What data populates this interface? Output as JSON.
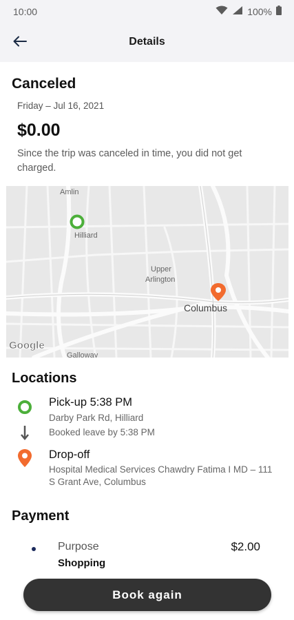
{
  "status_bar": {
    "time": "10:00",
    "battery": "100%",
    "icons": [
      "wifi-icon",
      "cell-signal-icon",
      "battery-icon"
    ]
  },
  "app_bar": {
    "back_icon": "arrow-left-icon",
    "title": "Details"
  },
  "trip": {
    "status": "Canceled",
    "date": "Friday – Jul 16, 2021",
    "amount": "$0.00",
    "note": "Since the trip was canceled in time, you did not get charged."
  },
  "map": {
    "labels": {
      "amlin": "Amlin",
      "hilliard": "Hilliard",
      "upper_arlington_1": "Upper",
      "upper_arlington_2": "Arlington",
      "columbus": "Columbus",
      "galloway": "Galloway",
      "google": "Google"
    },
    "colors": {
      "pickup": "#4caf3a",
      "dropoff": "#f26b2e"
    }
  },
  "locations": {
    "title": "Locations",
    "pickup": {
      "label": "Pick-up 5:38 PM",
      "address": "Darby Park Rd, Hilliard",
      "booked": "Booked leave by 5:38 PM"
    },
    "dropoff": {
      "label": "Drop-off",
      "address": "Hospital Medical Services Chawdry Fatima I MD – 111 S Grant Ave, Columbus"
    }
  },
  "payment": {
    "title": "Payment",
    "label": "Purpose",
    "value": "Shopping",
    "amount": "$2.00"
  },
  "actions": {
    "book_again": "Book again"
  },
  "colors": {
    "header_bg": "#f3f3f6",
    "button_bg": "#333333",
    "payment_dot": "#1b2a5c"
  }
}
